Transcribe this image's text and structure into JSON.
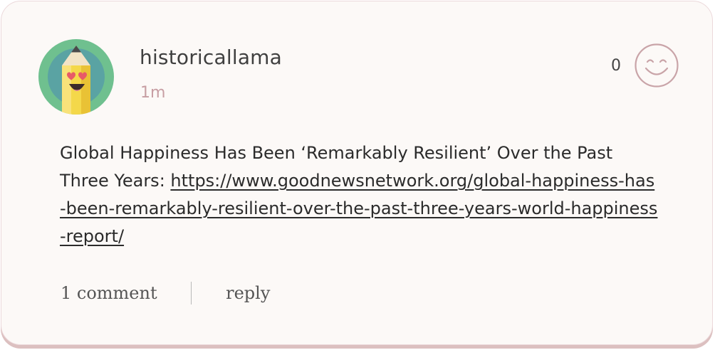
{
  "post": {
    "author": "historicallama",
    "timestamp": "1m",
    "text": "Global Happiness Has Been ‘Remarkably Resilient’ Over the Past Three Years: ",
    "link": "https://www.goodnewsnetwork.org/global-happiness-has-been-remarkably-resilient-over-the-past-three-years-world-happiness-report/"
  },
  "reaction": {
    "count": "0",
    "icon": "smiley-icon"
  },
  "avatar": {
    "icon": "pencil-heart-eyes-icon"
  },
  "footer": {
    "comments_label": "1 comment",
    "reply_label": "reply"
  },
  "colors": {
    "card_background": "#fcf9f7",
    "card_border": "#ecd9db",
    "timestamp": "#c79ea3",
    "smiley_stroke": "#c9a4a8",
    "avatar_ring": "#6fc08f",
    "avatar_inner": "#5aa3a3"
  }
}
